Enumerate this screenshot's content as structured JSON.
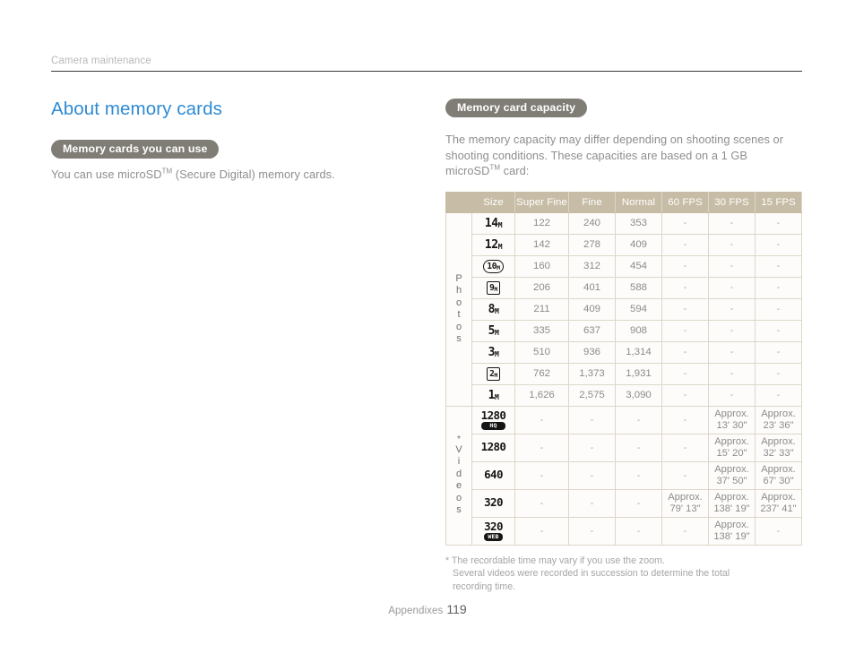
{
  "header": {
    "breadcrumb": "Camera maintenance"
  },
  "left": {
    "title": "About memory cards",
    "badge": "Memory cards you can use",
    "paragraph_pre": "You can use microSD",
    "paragraph_sup": "TM",
    "paragraph_post": " (Secure Digital) memory cards."
  },
  "right": {
    "badge": "Memory card capacity",
    "paragraph_pre": "The memory capacity may differ depending on shooting scenes or shooting conditions. These capacities are based on a 1 GB microSD",
    "paragraph_sup": "TM",
    "paragraph_post": " card:"
  },
  "table": {
    "headers": [
      "Size",
      "Super Fine",
      "Fine",
      "Normal",
      "60 FPS",
      "30 FPS",
      "15 FPS"
    ],
    "photos_label": "Photos",
    "videos_label": "Videos",
    "videos_star": "*",
    "dash": "-",
    "approx": "Approx.",
    "photo_rows": [
      {
        "size_num": "14",
        "size_unit": "M",
        "style": "plain",
        "super_fine": "122",
        "fine": "240",
        "normal": "353",
        "fps60": "-",
        "fps30": "-",
        "fps15": "-"
      },
      {
        "size_num": "12",
        "size_unit": "M",
        "style": "plain",
        "super_fine": "142",
        "fine": "278",
        "normal": "409",
        "fps60": "-",
        "fps30": "-",
        "fps15": "-"
      },
      {
        "size_num": "10",
        "size_unit": "M",
        "style": "round",
        "super_fine": "160",
        "fine": "312",
        "normal": "454",
        "fps60": "-",
        "fps30": "-",
        "fps15": "-"
      },
      {
        "size_num": "9",
        "size_unit": "M",
        "style": "boxed",
        "super_fine": "206",
        "fine": "401",
        "normal": "588",
        "fps60": "-",
        "fps30": "-",
        "fps15": "-"
      },
      {
        "size_num": "8",
        "size_unit": "M",
        "style": "plain",
        "super_fine": "211",
        "fine": "409",
        "normal": "594",
        "fps60": "-",
        "fps30": "-",
        "fps15": "-"
      },
      {
        "size_num": "5",
        "size_unit": "M",
        "style": "plain",
        "super_fine": "335",
        "fine": "637",
        "normal": "908",
        "fps60": "-",
        "fps30": "-",
        "fps15": "-"
      },
      {
        "size_num": "3",
        "size_unit": "M",
        "style": "plain",
        "super_fine": "510",
        "fine": "936",
        "normal": "1,314",
        "fps60": "-",
        "fps30": "-",
        "fps15": "-"
      },
      {
        "size_num": "2",
        "size_unit": "M",
        "style": "boxed",
        "super_fine": "762",
        "fine": "1,373",
        "normal": "1,931",
        "fps60": "-",
        "fps30": "-",
        "fps15": "-"
      },
      {
        "size_num": "1",
        "size_unit": "M",
        "style": "plain",
        "super_fine": "1,626",
        "fine": "2,575",
        "normal": "3,090",
        "fps60": "-",
        "fps30": "-",
        "fps15": "-"
      }
    ],
    "video_rows": [
      {
        "size_num": "1280",
        "tag": "HQ",
        "super_fine": "-",
        "fine": "-",
        "normal": "-",
        "fps60": "-",
        "fps30": "Approx. 13' 30\"",
        "fps15": "Approx. 23' 36\""
      },
      {
        "size_num": "1280",
        "tag": "",
        "super_fine": "-",
        "fine": "-",
        "normal": "-",
        "fps60": "-",
        "fps30": "Approx. 15' 20\"",
        "fps15": "Approx. 32' 33\""
      },
      {
        "size_num": "640",
        "tag": "",
        "super_fine": "-",
        "fine": "-",
        "normal": "-",
        "fps60": "-",
        "fps30": "Approx. 37' 50\"",
        "fps15": "Approx. 67' 30\""
      },
      {
        "size_num": "320",
        "tag": "",
        "super_fine": "-",
        "fine": "-",
        "normal": "-",
        "fps60": "Approx. 79' 13\"",
        "fps30": "Approx. 138' 19\"",
        "fps15": "Approx. 237' 41\""
      },
      {
        "size_num": "320",
        "tag": "WEB",
        "super_fine": "-",
        "fine": "-",
        "normal": "-",
        "fps60": "-",
        "fps30": "Approx. 138' 19\"",
        "fps15": "-"
      }
    ]
  },
  "footnote": {
    "line1": "* The recordable time may vary if you use the zoom.",
    "line2": "Several videos were recorded in succession to determine the total",
    "line3": "recording time."
  },
  "footer": {
    "label": "Appendixes",
    "page": "119"
  },
  "colors": {
    "heading_blue": "#2e8bd4",
    "pill_gray": "#807d76",
    "table_header_tan": "#c7bca6",
    "table_border": "#ded7c8",
    "body_gray": "#8e8e8e"
  }
}
